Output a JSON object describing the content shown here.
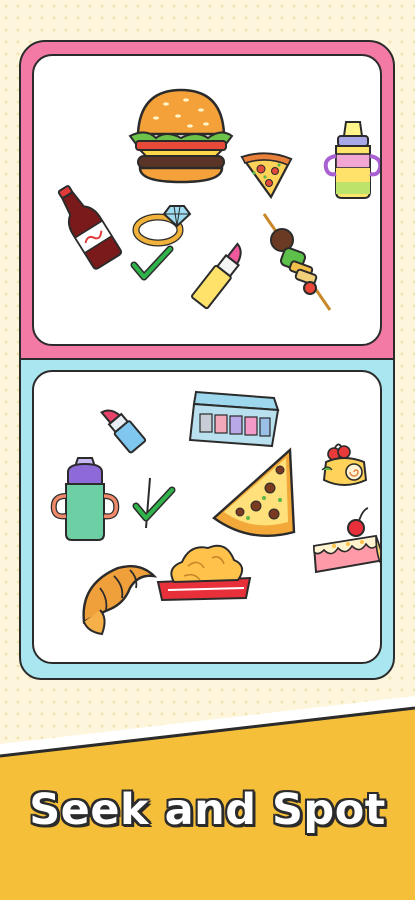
{
  "title": "Seek and Spot",
  "colors": {
    "top_frame": "#f47aa6",
    "bottom_frame": "#a9e6f0",
    "banner": "#f6bf3a",
    "check": "#2fb34a"
  },
  "top_panel": {
    "items": [
      "hamburger-icon",
      "pizza-slice-icon",
      "baby-bottle-icon",
      "cola-bottle-icon",
      "diamond-ring-icon",
      "lipstick-icon",
      "kebab-skewer-icon"
    ],
    "found": [
      "checkmark-icon"
    ]
  },
  "bottom_panel": {
    "items": [
      "lipstick-icon",
      "eyeshadow-palette-icon",
      "baby-bottle-icon",
      "pizza-slice-icon",
      "cherry-cake-roll-icon",
      "strawberry-cake-icon",
      "croissant-icon",
      "chicken-nuggets-icon"
    ],
    "found": [
      "checkmark-icon"
    ]
  }
}
